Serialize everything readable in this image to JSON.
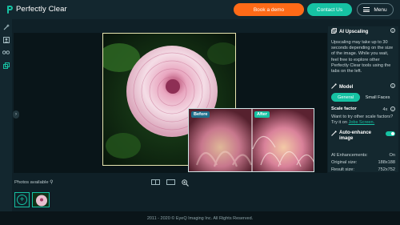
{
  "header": {
    "logo_text": "Perfectly Clear",
    "book_demo_label": "Book a demo",
    "contact_label": "Contact Us",
    "menu_label": "Menu"
  },
  "tools": [
    {
      "name": "magic-wand-icon",
      "glyph": "✦"
    },
    {
      "name": "portrait-icon",
      "glyph": "☺"
    },
    {
      "name": "glasses-icon",
      "glyph": "◎"
    },
    {
      "name": "upscale-icon",
      "glyph": "⧉"
    }
  ],
  "viewer": {
    "before_label": "Before",
    "after_label": "After",
    "photos_label": "Photos available"
  },
  "panel": {
    "upscaling": {
      "title": "AI Upscaling",
      "description": "Upscaling may take up to 30 seconds depending on the size of the image. While you wait, feel free to explore other Perfectly Clear tools using the tabs on the left."
    },
    "model": {
      "title": "Model",
      "options": [
        "General",
        "Small Faces"
      ],
      "selected": "General"
    },
    "scale": {
      "title": "Scale factor",
      "value": "4x",
      "hint": "Want to try other scale factors? Try it on",
      "link": "Jobs Screen."
    },
    "auto_enhance": {
      "label": "Auto-enhance image",
      "enabled": true
    },
    "stats": [
      {
        "label": "AI Enhancements:",
        "value": "On"
      },
      {
        "label": "Original size:",
        "value": "188x188"
      },
      {
        "label": "Result size:",
        "value": "752x752"
      }
    ]
  },
  "footer": {
    "copyright": "2011 - 2020 © EyeQ Imaging Inc. All Rights Reserved."
  },
  "colors": {
    "accent": "#16c2a3",
    "cta": "#ff6a17",
    "background": "#0f2027"
  }
}
